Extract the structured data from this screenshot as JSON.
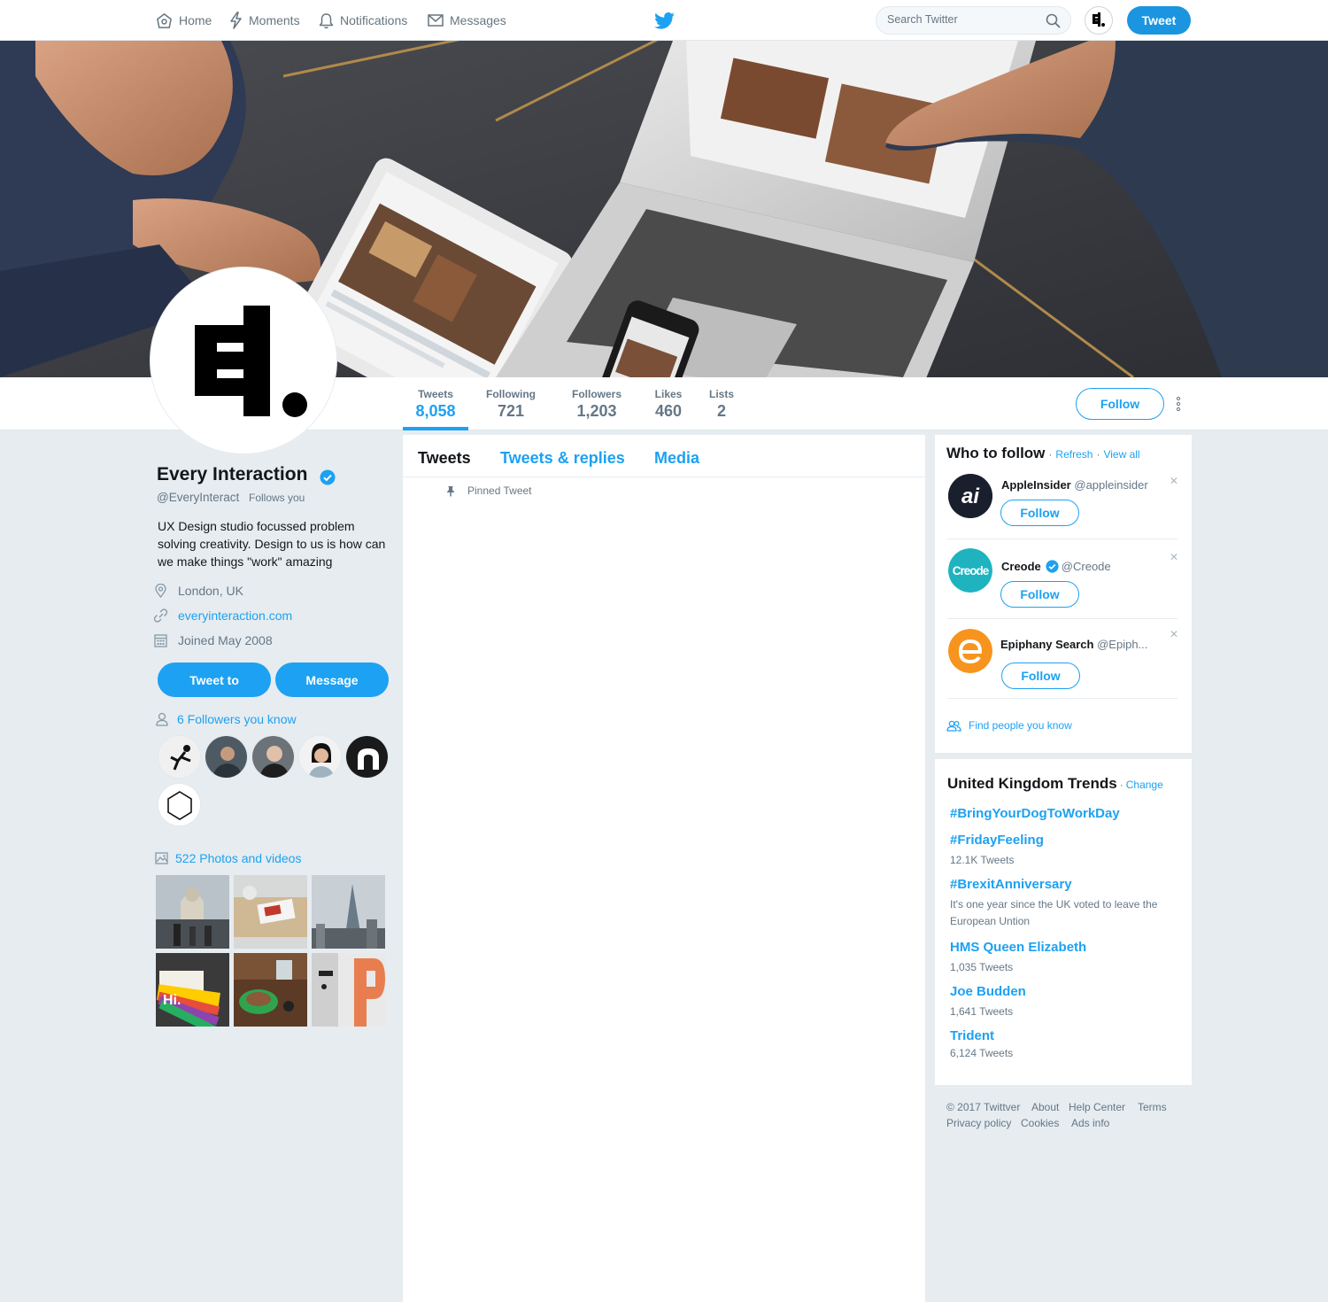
{
  "nav": {
    "home": "Home",
    "moments": "Moments",
    "notifications": "Notifications",
    "messages": "Messages",
    "search_placeholder": "Search Twitter",
    "tweet_button": "Tweet"
  },
  "stats": [
    {
      "label": "Tweets",
      "value": "8,058",
      "active": true
    },
    {
      "label": "Following",
      "value": "721"
    },
    {
      "label": "Followers",
      "value": "1,203"
    },
    {
      "label": "Likes",
      "value": "460"
    },
    {
      "label": "Lists",
      "value": "2"
    }
  ],
  "follow_button": "Follow",
  "profile": {
    "name": "Every Interaction",
    "handle": "@EveryInteract",
    "follows_you": "Follows you",
    "bio": "UX Design studio focussed problem solving creativity. Design to us is how can we make things \"work\" amazing",
    "location": "London, UK",
    "website": "everyinteraction.com",
    "joined": "Joined May 2008",
    "tweet_to": "Tweet to",
    "message": "Message",
    "followers_you_know": "6 Followers you know",
    "photos_videos": "522 Photos and videos"
  },
  "timeline": {
    "tabs": [
      "Tweets",
      "Tweets & replies",
      "Media"
    ],
    "pinned": "Pinned Tweet"
  },
  "who_to_follow": {
    "title": "Who to follow",
    "refresh": "Refresh",
    "view_all": "View all",
    "accounts": [
      {
        "name": "AppleInsider",
        "handle": "@appleinsider",
        "follow": "Follow"
      },
      {
        "name": "Creode",
        "handle": "@Creode",
        "follow": "Follow"
      },
      {
        "name": "Epiphany Search",
        "handle": "@Epiph...",
        "follow": "Follow"
      }
    ],
    "find_people": "Find people you know"
  },
  "trends": {
    "title": "United Kingdom Trends",
    "change": "Change",
    "items": [
      {
        "name": "#BringYourDogToWorkDay",
        "sub": ""
      },
      {
        "name": "#FridayFeeling",
        "sub": "12.1K Tweets"
      },
      {
        "name": "#BrexitAnniversary",
        "sub": "It's one year since the UK voted to leave the European Untion"
      },
      {
        "name": "HMS Queen Elizabeth",
        "sub": "1,035 Tweets"
      },
      {
        "name": "Joe Budden",
        "sub": "1,641 Tweets"
      },
      {
        "name": "Trident",
        "sub": "6,124 Tweets"
      }
    ]
  },
  "footer": [
    "© 2017 Twittver",
    "About",
    "Help Center",
    "Terms",
    "Privacy policy",
    "Cookies",
    "Ads info"
  ],
  "colors": {
    "accent": "#1da1f2",
    "background": "#e6ecf0",
    "creode": "#1fb3c0",
    "epiphany": "#f7941d"
  }
}
